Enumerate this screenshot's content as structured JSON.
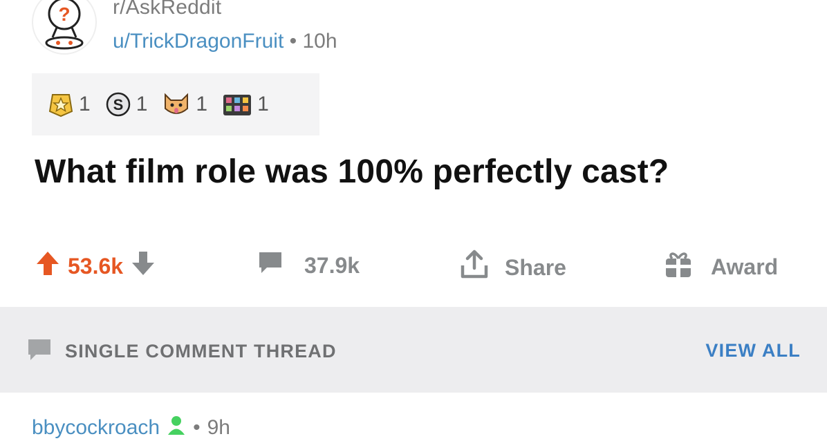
{
  "post": {
    "subreddit": "r/AskReddit",
    "author": "u/TrickDragonFruit",
    "separator": "•",
    "age": "10h",
    "title": "What film role was 100% perfectly cast?"
  },
  "awards": [
    {
      "icon": "gold-award-icon",
      "count": "1"
    },
    {
      "icon": "silver-award-icon",
      "count": "1"
    },
    {
      "icon": "cat-award-icon",
      "count": "1"
    },
    {
      "icon": "wholesome-award-icon",
      "count": "1"
    }
  ],
  "actions": {
    "score": "53.6k",
    "comments": "37.9k",
    "share_label": "Share",
    "award_label": "Award"
  },
  "thread": {
    "title": "SINGLE COMMENT THREAD",
    "view_all": "VIEW ALL"
  },
  "next_comment": {
    "author": "bbycockroach",
    "age": "9h"
  },
  "colors": {
    "upvote": "#e65723",
    "link": "#4a8fc1",
    "view_all": "#3b7fc4",
    "muted": "#878a8c",
    "banner": "#ededef"
  }
}
